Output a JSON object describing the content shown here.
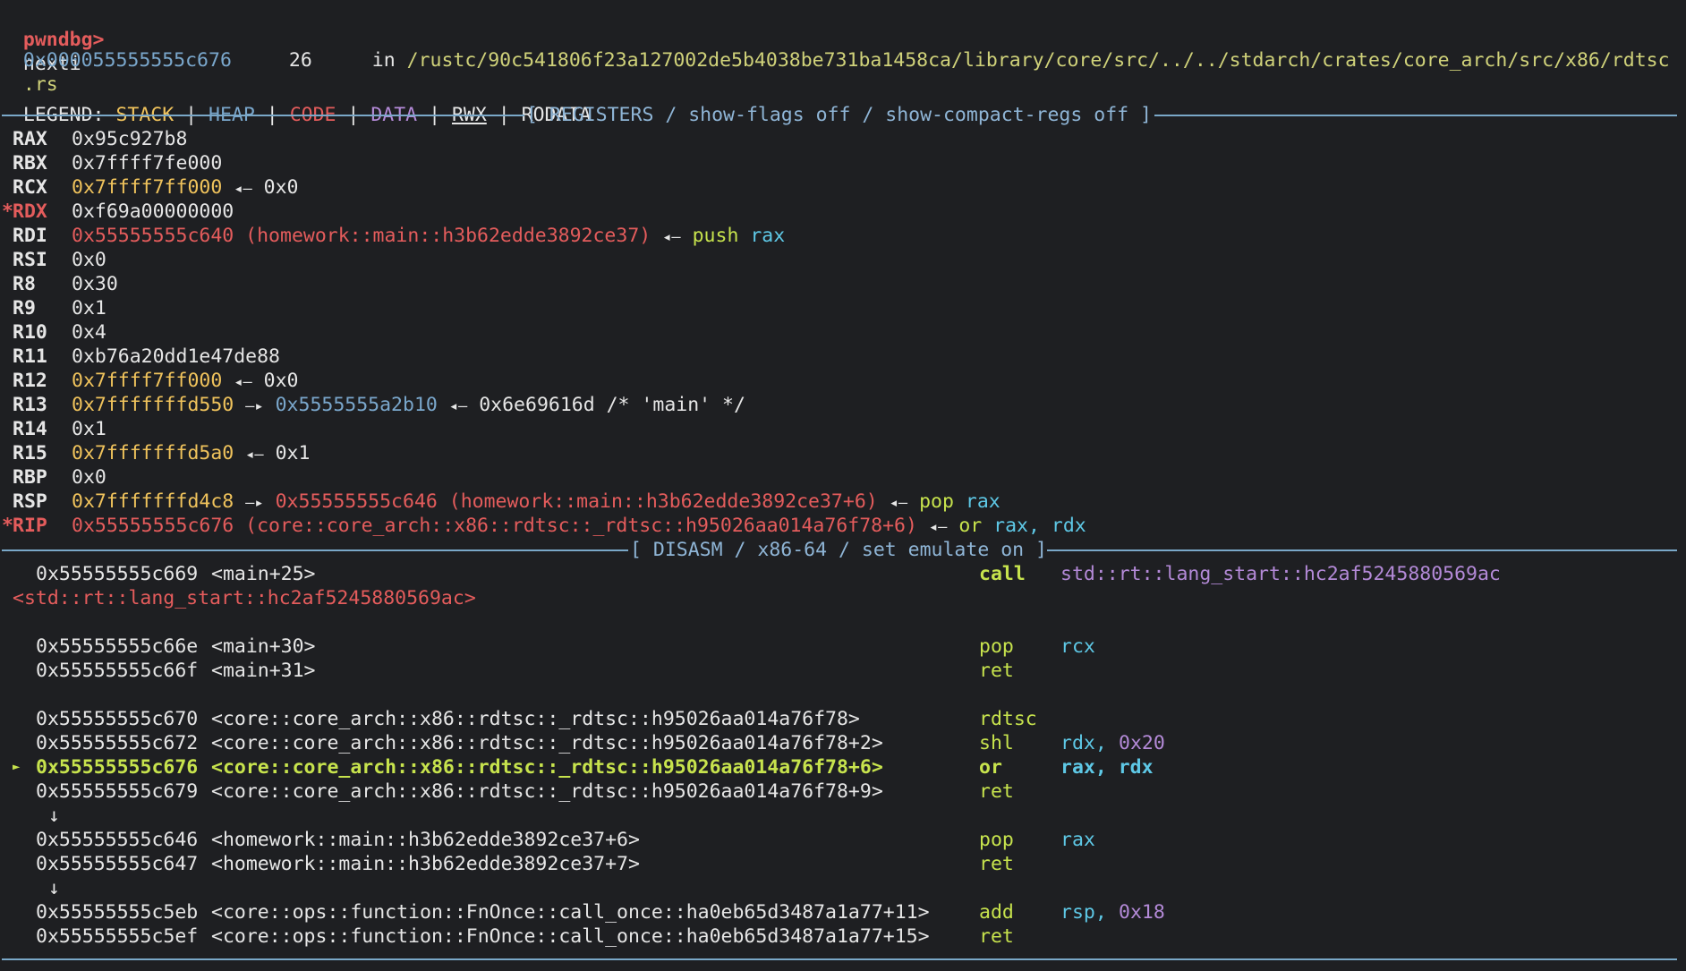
{
  "prompt": {
    "label": "pwndbg>",
    "command": "nexti"
  },
  "location": {
    "addr": "0x000055555555c676",
    "line": "26",
    "in": "in",
    "path": "/rustc/90c541806f23a127002de5b4038be731ba1458ca/library/core/src/../../stdarch/crates/core_arch/src/x86/rdtsc",
    "path_tail": ".rs"
  },
  "legend": {
    "label": "LEGEND:",
    "items": [
      "STACK",
      "HEAP",
      "CODE",
      "DATA",
      "RWX",
      "RODATA"
    ],
    "sep": "|"
  },
  "registers_header": "[ REGISTERS / show-flags off / show-compact-regs off ]",
  "registers": [
    {
      "name": "RAX",
      "mod": "",
      "val": "0x95c927b8"
    },
    {
      "name": "RBX",
      "mod": "",
      "val": "0x7ffff7fe000"
    },
    {
      "name": "RCX",
      "mod": "",
      "val": "0x7ffff7ff000",
      "arrow": "◂—",
      "deref": "0x0"
    },
    {
      "name": "RDX",
      "mod": "*",
      "val": "0xf69a00000000"
    },
    {
      "name": "RDI",
      "mod": "",
      "val": "0x55555555c640 (homework::main::h3b62edde3892ce37)",
      "arrow": "◂—",
      "ins": "push",
      "op": "rax"
    },
    {
      "name": "RSI",
      "mod": "",
      "val": "0x0"
    },
    {
      "name": "R8",
      "mod": "",
      "val": "0x30"
    },
    {
      "name": "R9",
      "mod": "",
      "val": "0x1"
    },
    {
      "name": "R10",
      "mod": "",
      "val": "0x4"
    },
    {
      "name": "R11",
      "mod": "",
      "val": "0xb76a20dd1e47de88"
    },
    {
      "name": "R12",
      "mod": "",
      "val": "0x7ffff7ff000",
      "arrow": "◂—",
      "deref": "0x0"
    },
    {
      "name": "R13",
      "mod": "",
      "val": "0x7fffffffd550",
      "arrow": "—▸",
      "heap": "0x5555555a2b10",
      "arrow2": "◂—",
      "deref": "0x6e69616d /* 'main' */"
    },
    {
      "name": "R14",
      "mod": "",
      "val": "0x1"
    },
    {
      "name": "R15",
      "mod": "",
      "val": "0x7fffffffd5a0",
      "arrow": "◂—",
      "deref": "0x1"
    },
    {
      "name": "RBP",
      "mod": "",
      "val": "0x0"
    },
    {
      "name": "RSP",
      "mod": "",
      "val": "0x7fffffffd4c8",
      "arrow": "—▸",
      "code": "0x55555555c646 (homework::main::h3b62edde3892ce37+6)",
      "arrow2": "◂—",
      "ins": "pop",
      "op": "rax"
    },
    {
      "name": "RIP",
      "mod": "*",
      "val": "0x55555555c676 (core::core_arch::x86::rdtsc::_rdtsc::h95026aa014a76f78+6)",
      "arrow": "◂—",
      "ins": "or",
      "op": "rax, rdx"
    }
  ],
  "disasm_header": "[ DISASM / x86-64 / set emulate on ]",
  "disasm": [
    {
      "addr": "0x55555555c669",
      "sym": "<main+25>",
      "mn": "call",
      "op": "std::rt::lang_start::hc2af5245880569ac"
    },
    {
      "wrap": "<std::rt::lang_start::hc2af5245880569ac>"
    },
    {
      "addr": "0x55555555c66e",
      "sym": "<main+30>",
      "mn": "pop",
      "op": "rcx"
    },
    {
      "addr": "0x55555555c66f",
      "sym": "<main+31>",
      "mn": "ret",
      "op": ""
    },
    {
      "addr": "0x55555555c670",
      "sym": "<core::core_arch::x86::rdtsc::_rdtsc::h95026aa014a76f78>",
      "mn": "rdtsc",
      "op": ""
    },
    {
      "addr": "0x55555555c672",
      "sym": "<core::core_arch::x86::rdtsc::_rdtsc::h95026aa014a76f78+2>",
      "mn": "shl",
      "op": "rdx,",
      "imm": "0x20"
    },
    {
      "addr": "0x55555555c676",
      "sym": "<core::core_arch::x86::rdtsc::_rdtsc::h95026aa014a76f78+6>",
      "mn": "or",
      "op": "rax, rdx",
      "current": true,
      "marker": "►"
    },
    {
      "addr": "0x55555555c679",
      "sym": "<core::core_arch::x86::rdtsc::_rdtsc::h95026aa014a76f78+9>",
      "mn": "ret",
      "op": ""
    },
    {
      "flow": "↓"
    },
    {
      "addr": "0x55555555c646",
      "sym": "<homework::main::h3b62edde3892ce37+6>",
      "mn": "pop",
      "op": "rax"
    },
    {
      "addr": "0x55555555c647",
      "sym": "<homework::main::h3b62edde3892ce37+7>",
      "mn": "ret",
      "op": ""
    },
    {
      "flow": "↓"
    },
    {
      "addr": "0x55555555c5eb",
      "sym": "<core::ops::function::FnOnce::call_once::ha0eb65d3487a1a77+11>",
      "mn": "add",
      "op": "rsp,",
      "imm": "0x18"
    },
    {
      "addr": "0x55555555c5ef",
      "sym": "<core::ops::function::FnOnce::call_once::ha0eb65d3487a1a77+15>",
      "mn": "ret",
      "op": ""
    }
  ],
  "colors": {
    "background": "#1e1f22",
    "text": "#d8dadf",
    "stack": "#f0c35c",
    "heap": "#7aa7cc",
    "code": "#e45c5c",
    "data": "#b48ad8",
    "rodata": "#e6e6e6",
    "mnemonic": "#c7e34d",
    "register": "#5ec8e6",
    "separator": "#7aa8c8"
  }
}
